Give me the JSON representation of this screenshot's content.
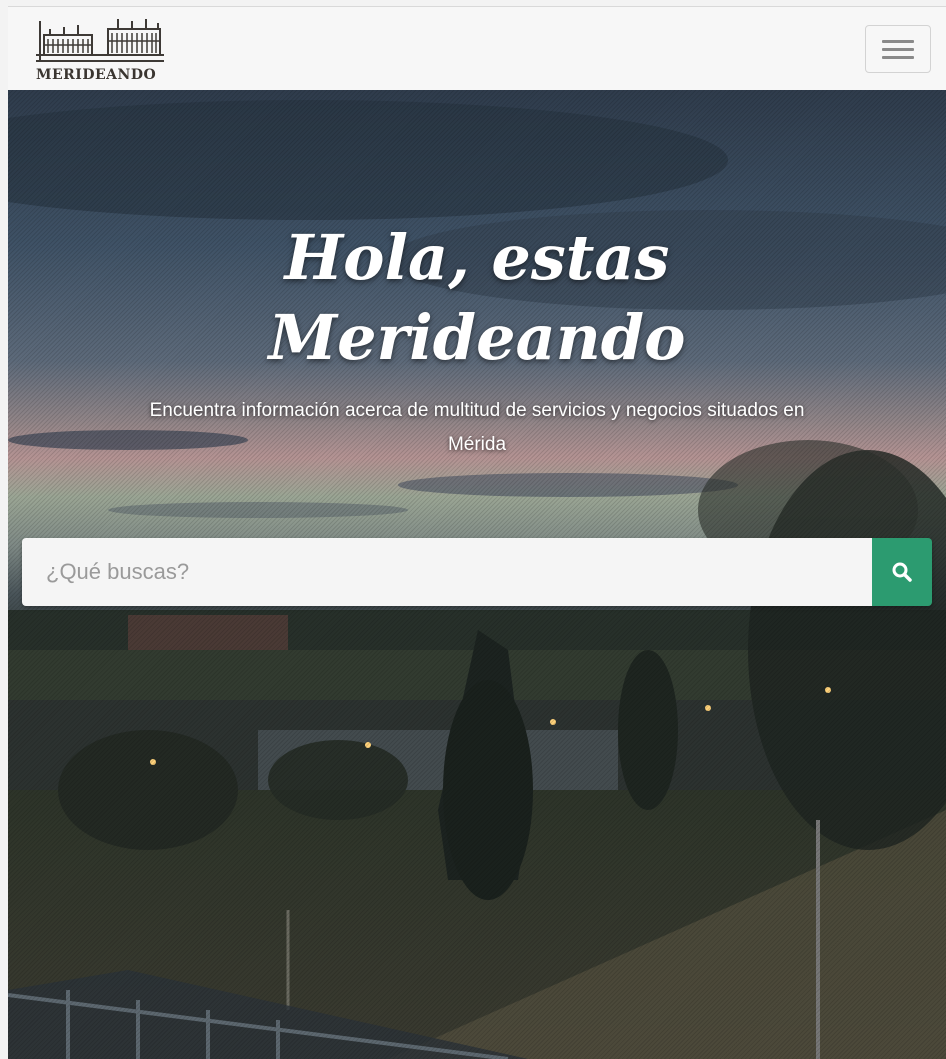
{
  "navbar": {
    "logo_text": "MERIDEANDO",
    "menu_toggle_icon": "hamburger-icon"
  },
  "hero": {
    "title_line1": "Hola, estas",
    "title_line2": "Merideando",
    "subtitle": "Encuentra información acerca de multitud de servicios y negocios situados en Mérida"
  },
  "search": {
    "placeholder": "¿Qué buscas?",
    "value": "",
    "button_icon": "search-icon"
  },
  "colors": {
    "accent": "#2c9b70",
    "navbar_bg": "#f7f7f7"
  }
}
